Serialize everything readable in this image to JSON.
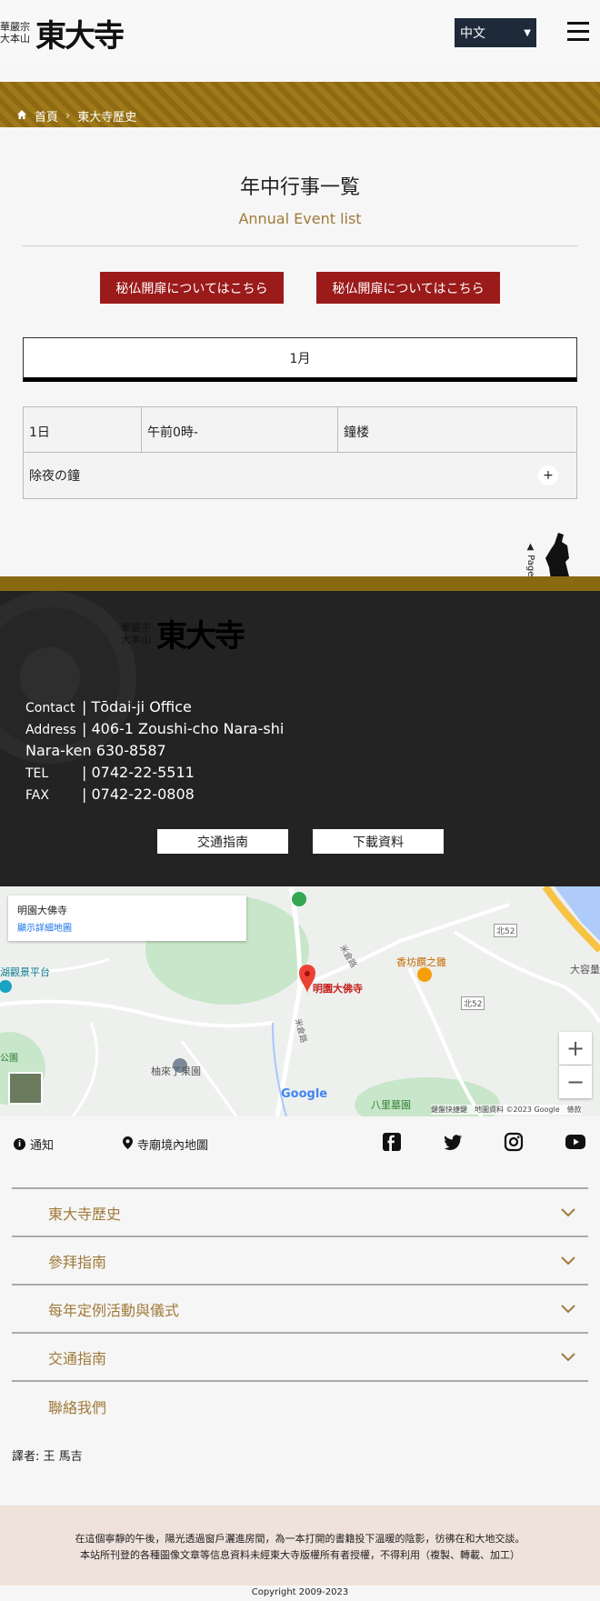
{
  "header": {
    "logo_small_line1": "華嚴宗",
    "logo_small_line2": "大本山",
    "logo_big": "東大寺",
    "lang_selected": "中文"
  },
  "breadcrumb": {
    "home": "首頁",
    "current": "東大寺歷史"
  },
  "page": {
    "title": "年中行事一覧",
    "subtitle": "Annual Event list",
    "btn_left": "秘仏開扉についてはこちら",
    "btn_right": "秘仏開扉についてはこちら",
    "month": "1月"
  },
  "event": {
    "date": "1日",
    "time": "午前0時-",
    "place": "鐘楼",
    "name": "除夜の鐘",
    "expand": "+"
  },
  "pagetop": "▲ Page top",
  "footer": {
    "logo_small_line1": "華嚴宗",
    "logo_small_line2": "大本山",
    "logo_big": "東大寺",
    "contact_label": "Contact",
    "contact_value": "| Tōdai-ji Office",
    "address_label": "Address",
    "address_value": "| 406-1 Zoushi-cho Nara-shi",
    "address_line2": "Nara-ken 630-8587",
    "tel_label": "TEL",
    "tel_value": "| 0742-22-5511",
    "fax_label": "FAX",
    "fax_value": "| 0742-22-0808",
    "btn_transport": "交通指南",
    "btn_download": "下載資料"
  },
  "map": {
    "card_title": "明園大佛寺",
    "card_link": "顯示詳細地圖",
    "pin_label": "明園大佛寺",
    "label_lake": "湖觀景平台",
    "label_fruit": "柚來了果園",
    "label_food": "香坊饌之雛",
    "label_park": "公園",
    "label_village": "八里墓園",
    "label_road1": "米倉路",
    "label_road2": "米倉路",
    "label_north52a": "北52",
    "label_north52b": "北52",
    "label_right": "大容量",
    "attribution": "鍵盤快捷鍵　地圖資料 ©2023 Google　條款",
    "google": "Google",
    "zoom_in": "+",
    "zoom_out": "−"
  },
  "links": {
    "notice": "通知",
    "temple_map": "寺廟境內地圖"
  },
  "accordion": [
    {
      "label": "東大寺歷史"
    },
    {
      "label": "參拜指南"
    },
    {
      "label": "每年定例活動與儀式"
    },
    {
      "label": "交通指南"
    },
    {
      "label": "聯絡我們"
    }
  ],
  "translator": "譯者: 王 馬吉",
  "notice_line1": "在這個寧靜的午後，陽光透過窗戶灑進房間，為一本打開的書籍投下溫暖的陰影，彷彿在和大地交談。",
  "notice_line2": "本站所刊登的各種圖像文章等信息資料未經東大寺版權所有者授權，不得利用（複製、轉載、加工）",
  "copyright": "Copyright 2009-2023",
  "colors": {
    "gold": "#a07a1a",
    "red_button": "#9b1a1a",
    "footer_bg": "#232323",
    "accordion_text": "#a07a3a"
  }
}
